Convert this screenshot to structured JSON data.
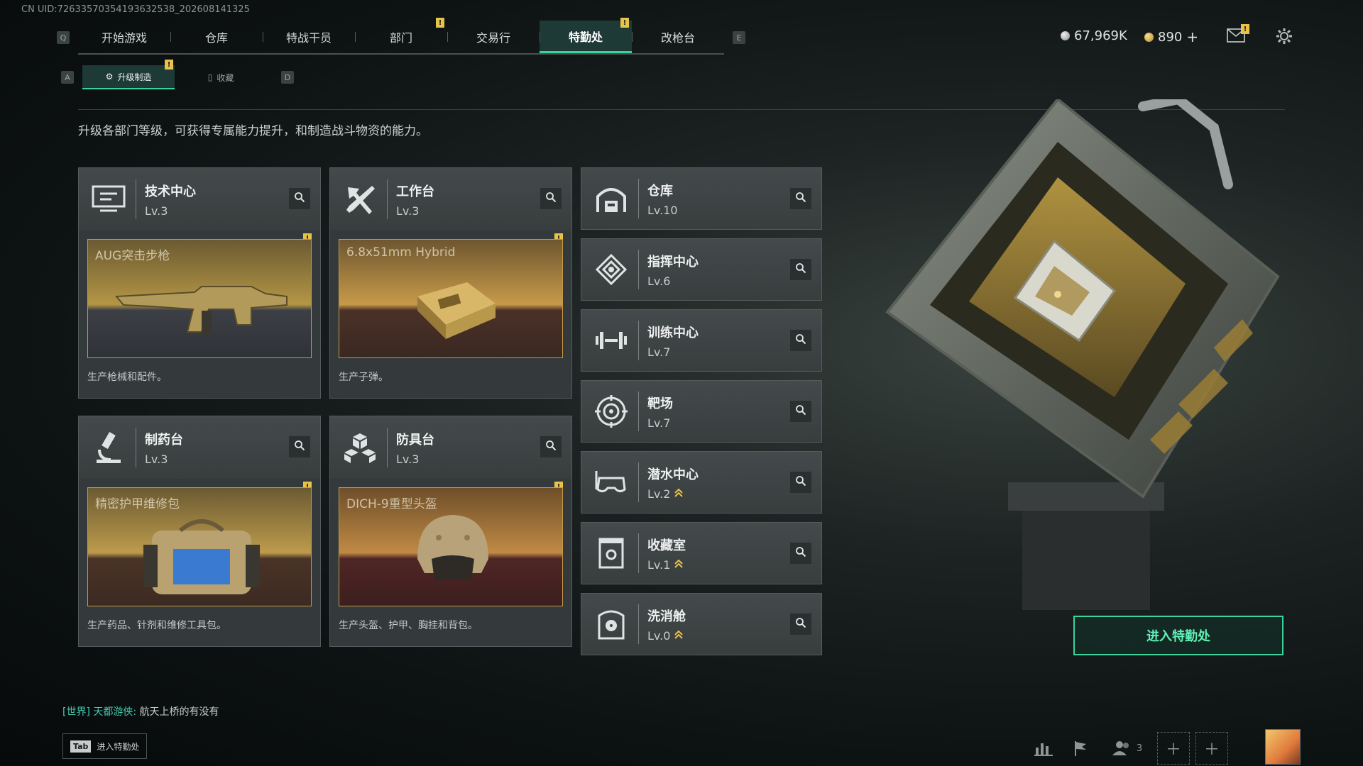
{
  "uid_text": "CN UID:7263357035419363253­8_202608141325",
  "top_nav": {
    "left_key": "Q",
    "right_key": "E",
    "tabs": [
      {
        "label": "开始游戏",
        "alert": false
      },
      {
        "label": "仓库",
        "alert": false
      },
      {
        "label": "特战干员",
        "alert": false
      },
      {
        "label": "部门",
        "alert": true
      },
      {
        "label": "交易行",
        "alert": false
      },
      {
        "label": "特勤处",
        "alert": true,
        "active": true
      },
      {
        "label": "改枪台",
        "alert": false
      }
    ]
  },
  "currency": {
    "silver": "67,969K",
    "gold": "890",
    "add": "+"
  },
  "alert_mark": "!",
  "sub_nav": {
    "left_key": "A",
    "right_key": "D",
    "tabs": [
      {
        "label": "升级制造",
        "active": true,
        "alert": true
      },
      {
        "label": "收藏",
        "active": false,
        "alert": false
      }
    ]
  },
  "description": "升级各部门等级，可获得专属能力提升，和制造战斗物资的能力。",
  "production_stations": [
    {
      "name": "技术中心",
      "level": "Lv.3",
      "icon": "monitor-icon",
      "product": "AUG突击步枪",
      "product_desc": "生产枪械和配件。"
    },
    {
      "name": "工作台",
      "level": "Lv.3",
      "icon": "tools-icon",
      "product": "6.8x51mm Hybrid",
      "product_desc": "生产子弹。"
    },
    {
      "name": "制药台",
      "level": "Lv.3",
      "icon": "microscope-icon",
      "product": "精密护甲维修包",
      "product_desc": "生产药品、针剂和维修工具包。"
    },
    {
      "name": "防具台",
      "level": "Lv.3",
      "icon": "cubes-icon",
      "product": "DICH-9重型头盔",
      "product_desc": "生产头盔、护甲、胸挂和背包。"
    }
  ],
  "facilities": [
    {
      "name": "仓库",
      "level": "Lv.10",
      "icon": "warehouse-icon",
      "upgradable": false
    },
    {
      "name": "指挥中心",
      "level": "Lv.6",
      "icon": "command-icon",
      "upgradable": false
    },
    {
      "name": "训练中心",
      "level": "Lv.7",
      "icon": "dumbbell-icon",
      "upgradable": false
    },
    {
      "name": "靶场",
      "level": "Lv.7",
      "icon": "target-icon",
      "upgradable": false
    },
    {
      "name": "潜水中心",
      "level": "Lv.2",
      "icon": "diving-mask-icon",
      "upgradable": true
    },
    {
      "name": "收藏室",
      "level": "Lv.1",
      "icon": "collection-icon",
      "upgradable": true
    },
    {
      "name": "洗消舱",
      "level": "Lv.0",
      "icon": "decontamination-icon",
      "upgradable": true
    }
  ],
  "enter_button": "进入特勤处",
  "chat": {
    "channel": "[世界]",
    "sender": "天都游侠:",
    "message": "航天上桥的有没有"
  },
  "tab_hint": {
    "key": "Tab",
    "label": "进入特勤处"
  },
  "friends_count": "3",
  "colors": {
    "accent": "#3ad39a",
    "alert": "#e8c34a",
    "upgrade_chevron": "#e8c34a"
  }
}
